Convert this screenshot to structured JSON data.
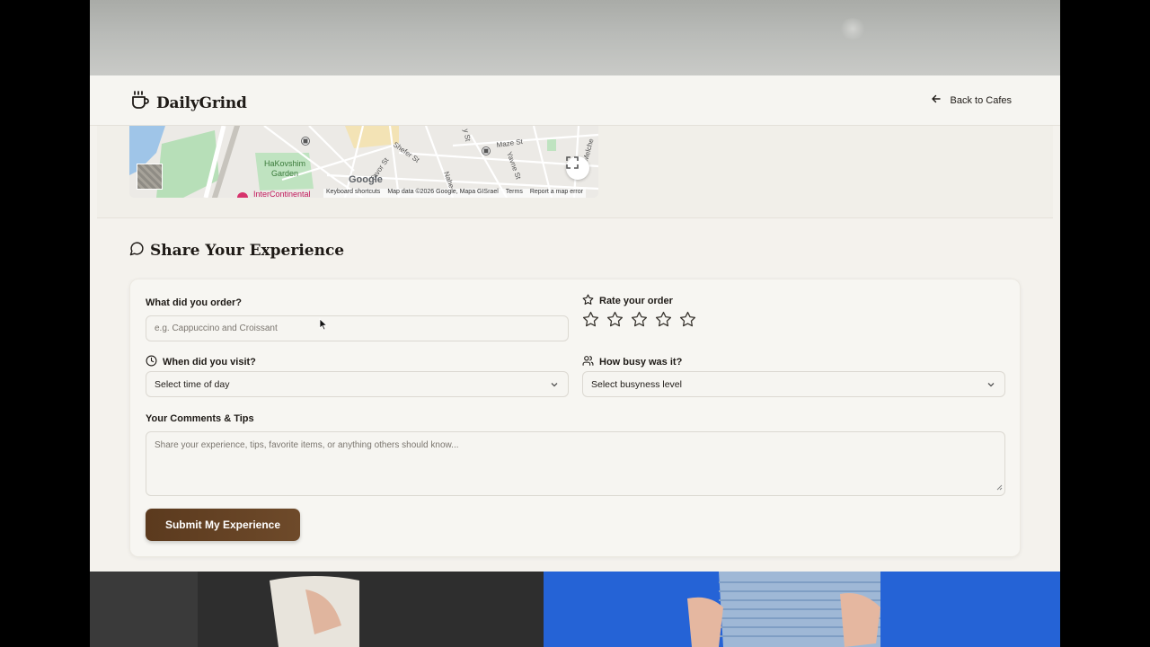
{
  "header": {
    "brand": "DailyGrind",
    "back_label": "Back to Cafes"
  },
  "map": {
    "labels": [
      "HaKovshim",
      "Garden",
      "Shefer St",
      "Maze St",
      "Yavne St",
      "Tavor St",
      "Nahe",
      "Melche",
      "y St"
    ],
    "google_logo": "Google",
    "hotel": "InterContinental",
    "attribution": {
      "shortcuts": "Keyboard shortcuts",
      "data": "Map data ©2026 Google, Mapa GISrael",
      "terms": "Terms",
      "report": "Report a map error"
    }
  },
  "section": {
    "title": "Share Your Experience"
  },
  "form": {
    "order_label": "What did you order?",
    "order_placeholder": "e.g. Cappuccino and Croissant",
    "rating_label": "Rate your order",
    "rating_value": 0,
    "rating_max": 5,
    "visit_label": "When did you visit?",
    "visit_value": "Select time of day",
    "busy_label": "How busy was it?",
    "busy_value": "Select busyness level",
    "comments_label": "Your Comments & Tips",
    "comments_placeholder": "Share your experience, tips, favorite items, or anything others should know...",
    "submit_label": "Submit My Experience"
  },
  "colors": {
    "accent": "#5b3a1e",
    "background": "#f4f2ed",
    "text": "#1e1a16"
  },
  "icons": [
    "coffee-cup-icon",
    "arrow-left-icon",
    "chat-bubble-icon",
    "star-icon",
    "clock-icon",
    "users-icon",
    "chevron-down-icon",
    "fullscreen-icon"
  ]
}
